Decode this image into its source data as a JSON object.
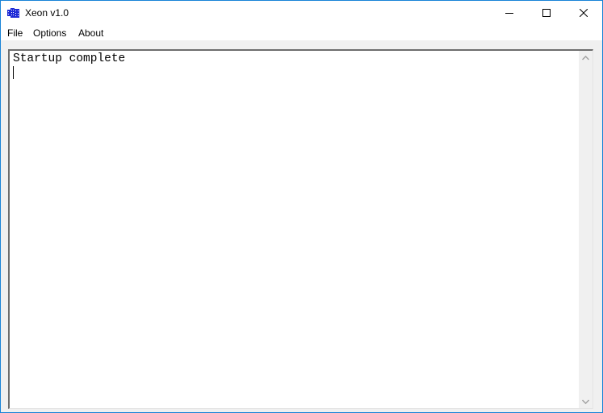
{
  "window": {
    "title": "Xeon v1.0",
    "icon": "app-icon",
    "controls": [
      "minimize-icon",
      "maximize-icon",
      "close-icon"
    ]
  },
  "menubar": {
    "items": [
      {
        "label": "File"
      },
      {
        "label": "Options"
      },
      {
        "label": "About"
      }
    ]
  },
  "console": {
    "text": "Startup complete",
    "scroll_up_icon": "chevron-up-icon",
    "scroll_down_icon": "chevron-down-icon"
  },
  "colors": {
    "border": "#1883d7",
    "app_icon": "#1e2bd6"
  }
}
